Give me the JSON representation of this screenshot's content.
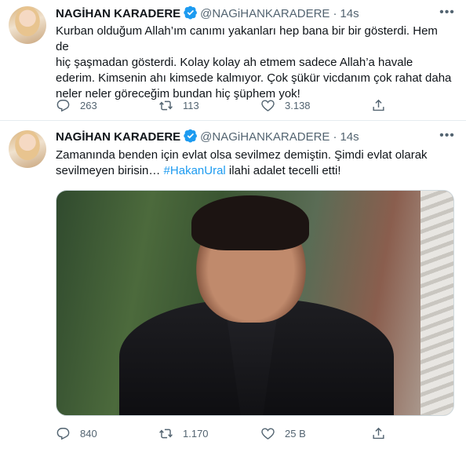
{
  "tweets": [
    {
      "author_name": "NAGİHAN KARADERE",
      "handle": "@NAGiHANKARADERE",
      "separator": "·",
      "time": "14s",
      "text": "Kurban olduğum Allah’ım canımı yakanları hep bana bir bir gösterdi. Hem de\nhiç şaşmadan gösterdi. Kolay kolay ah etmem sadece Allah’a havale\nederim. Kimsenin ahı kimsede kalmıyor. Çok şükür vicdanım çok rahat daha\nneler neler göreceğim bundan hiç şüphem yok!",
      "replies": "263",
      "retweets": "113",
      "likes": "3.138"
    },
    {
      "author_name": "NAGİHAN KARADERE",
      "handle": "@NAGiHANKARADERE",
      "separator": "·",
      "time": "14s",
      "text_before": "Zamanında benden için evlat olsa sevilmez demiştin. Şimdi evlat olarak\nsevilmeyen birisin… ",
      "hashtag": "#HakanUral",
      "text_after": " ilahi adalet tecelli etti!",
      "replies": "840",
      "retweets": "1.170",
      "likes": "25 B"
    }
  ],
  "icons": {
    "verified": "verified-badge-icon",
    "more": "more-options-icon",
    "reply": "reply-icon",
    "retweet": "retweet-icon",
    "like": "heart-icon",
    "share": "share-icon"
  },
  "colors": {
    "verified_blue": "#1d9bf0",
    "hashtag_blue": "#1d9bf0",
    "secondary_text": "#536471"
  }
}
